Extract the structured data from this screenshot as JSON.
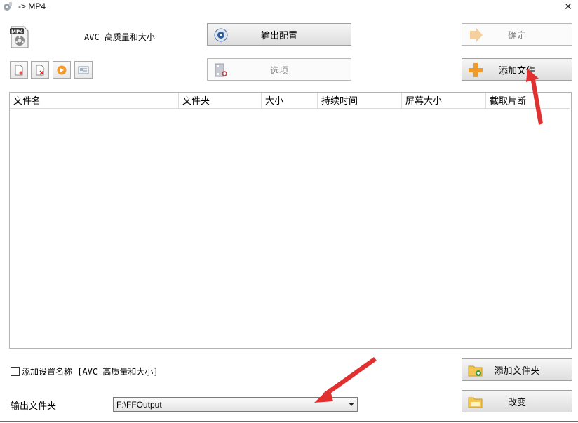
{
  "window": {
    "title": "-> MP4",
    "close_glyph": "✕"
  },
  "profile": {
    "text": "AVC 高质量和大小",
    "icon": "mp4-file-icon"
  },
  "toolbar": {
    "output_config_label": "输出配置",
    "options_label": "选项",
    "confirm_label": "确定",
    "add_file_label": "添加文件"
  },
  "tools": [
    {
      "name": "new-task-icon"
    },
    {
      "name": "remove-task-icon"
    },
    {
      "name": "play-icon"
    },
    {
      "name": "info-icon"
    }
  ],
  "file_list": {
    "columns": [
      "文件名",
      "文件夹",
      "大小",
      "持续时间",
      "屏幕大小",
      "截取片断"
    ],
    "rows": []
  },
  "add_setting_name": {
    "label": "添加设置名称 [AVC 高质量和大小]",
    "checked": false
  },
  "output_folder": {
    "label": "输出文件夹",
    "value": "F:\\FFOutput"
  },
  "buttons": {
    "add_folder_label": "添加文件夹",
    "change_label": "改变"
  },
  "colors": {
    "annotation_arrow": "#e03030",
    "plus_orange": "#f09a2a"
  }
}
